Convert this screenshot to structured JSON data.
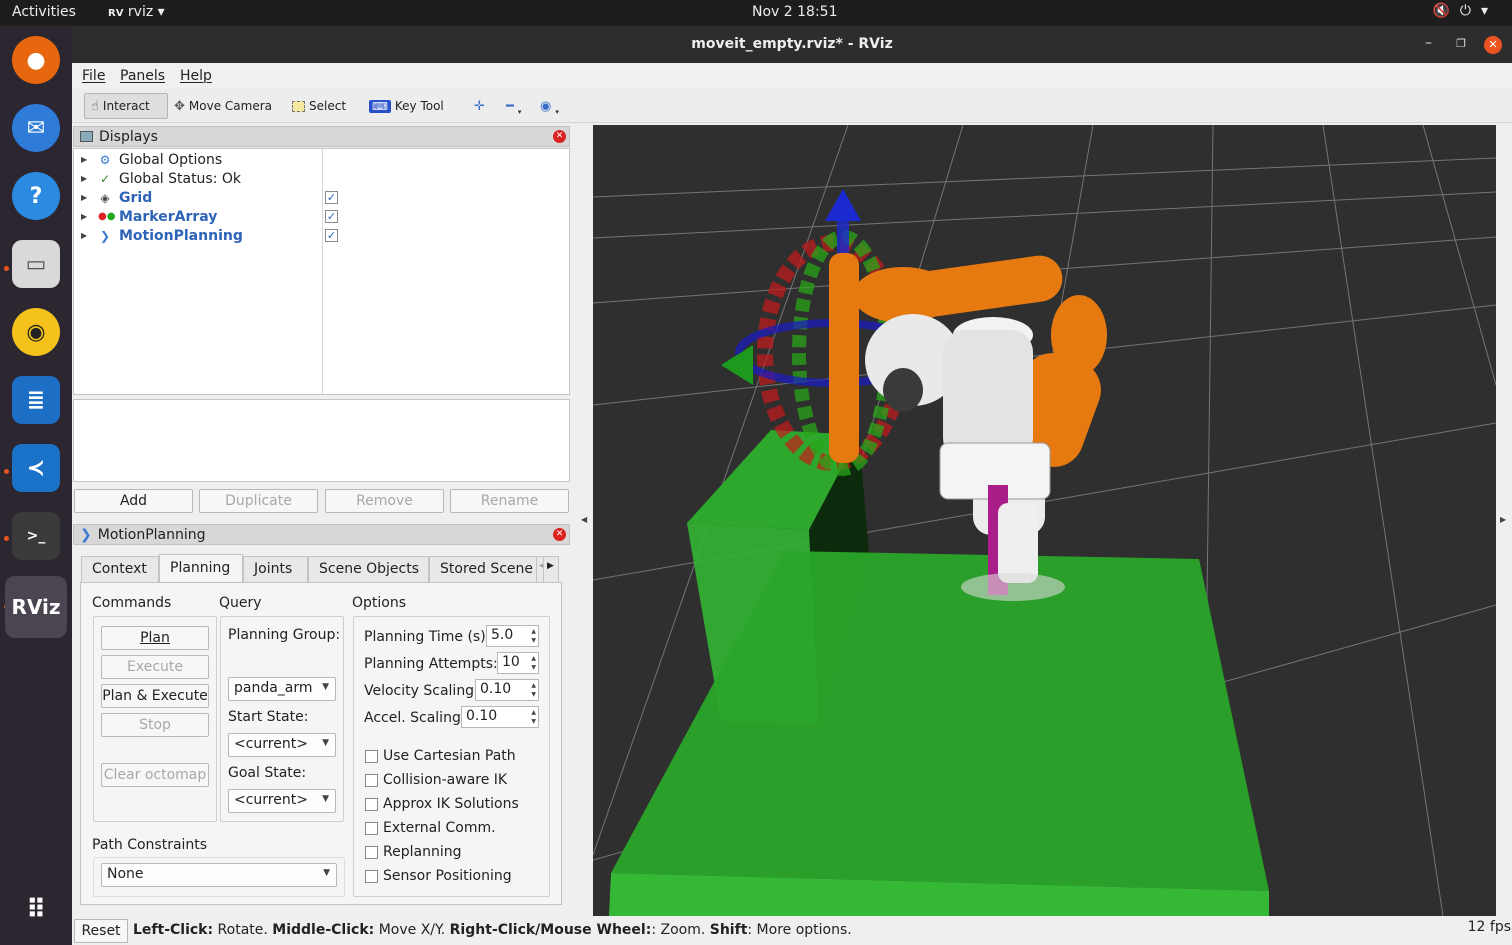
{
  "topbar": {
    "activities": "Activities",
    "app_name": "rviz",
    "clock": "Nov 2  18:51"
  },
  "window": {
    "title": "moveit_empty.rviz* - RViz"
  },
  "menu": {
    "file": "File",
    "panels": "Panels",
    "help": "Help"
  },
  "toolbar": {
    "interact": "Interact",
    "move_camera": "Move Camera",
    "select": "Select",
    "key_tool": "Key Tool"
  },
  "displays": {
    "title": "Displays",
    "items": [
      {
        "label": "Global Options"
      },
      {
        "label": "Global Status: Ok"
      },
      {
        "label": "Grid",
        "checked": true
      },
      {
        "label": "MarkerArray",
        "checked": true
      },
      {
        "label": "MotionPlanning",
        "checked": true
      }
    ],
    "buttons": {
      "add": "Add",
      "duplicate": "Duplicate",
      "remove": "Remove",
      "rename": "Rename"
    }
  },
  "motion": {
    "title": "MotionPlanning",
    "tabs": [
      "Context",
      "Planning",
      "Joints",
      "Scene Objects",
      "Stored Scene"
    ],
    "commands": {
      "title": "Commands",
      "plan": "Plan",
      "execute": "Execute",
      "plan_execute": "Plan & Execute",
      "stop": "Stop",
      "clear_octomap": "Clear octomap"
    },
    "query": {
      "title": "Query",
      "planning_group_label": "Planning Group:",
      "planning_group": "panda_arm",
      "start_state_label": "Start State:",
      "start_state": "<current>",
      "goal_state_label": "Goal State:",
      "goal_state": "<current>"
    },
    "options": {
      "title": "Options",
      "planning_time_label": "Planning Time (s):",
      "planning_time": "5.0",
      "planning_attempts_label": "Planning Attempts:",
      "planning_attempts": "10",
      "velocity_label": "Velocity Scaling:",
      "velocity": "0.10",
      "accel_label": "Accel. Scaling:",
      "accel": "0.10",
      "checks": [
        "Use Cartesian Path",
        "Collision-aware IK",
        "Approx IK Solutions",
        "External Comm.",
        "Replanning",
        "Sensor Positioning"
      ]
    },
    "path_constraints": {
      "label": "Path Constraints",
      "value": "None"
    }
  },
  "status": {
    "reset": "Reset",
    "k1": "Left-Click:",
    "v1": " Rotate. ",
    "k2": "Middle-Click:",
    "v2": " Move X/Y. ",
    "k3": "Right-Click/Mouse Wheel:",
    "v3": ": Zoom. ",
    "k4": "Shift",
    "v4": ": More options.",
    "fps": "12 fps"
  }
}
